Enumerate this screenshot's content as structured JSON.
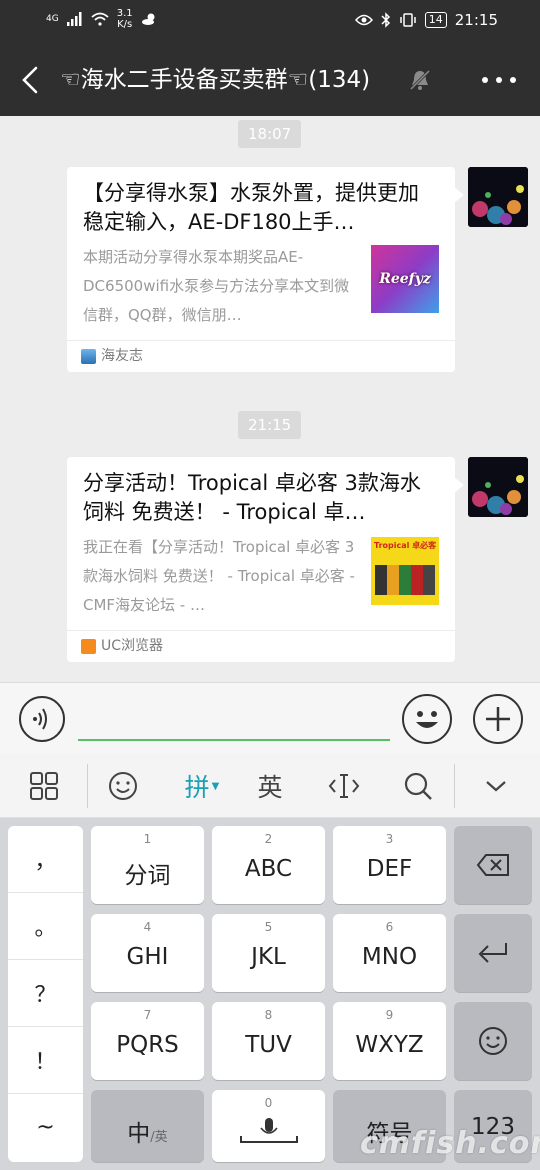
{
  "status_bar": {
    "network": "4G",
    "speed_value": "3.1",
    "speed_unit": "K/s",
    "battery": "14",
    "time": "21:15"
  },
  "header": {
    "title": "☜海水二手设备买卖群☜(134)"
  },
  "chat": {
    "messages": [
      {
        "timestamp": "18:07",
        "title": "【分享得水泵】水泵外置，提供更加稳定输入，AE-DF180上手…",
        "description": "本期活动分享得水泵本期奖品AE-DC6500wifi水泵参与方法分享本文到微信群，QQ群，微信朋…",
        "thumb_text": "Reefyz",
        "source": "海友志"
      },
      {
        "timestamp": "21:15",
        "title": "分享活动！Tropical 卓必客 3款海水饲料 免费送！ - Tropical 卓…",
        "description": "我正在看【分享活动！Tropical 卓必客 3款海水饲料 免费送！ - Tropical 卓必客 - CMF海友论坛 - …",
        "thumb_text": "Tropical 卓必客",
        "source": "UC浏览器"
      }
    ]
  },
  "ime_toolbar": {
    "pinyin_label": "拼",
    "english_label": "英"
  },
  "keyboard": {
    "punctuation": [
      "，",
      "。",
      "？",
      "！",
      "~"
    ],
    "keys": [
      {
        "num": "1",
        "label": "分词"
      },
      {
        "num": "2",
        "label": "ABC"
      },
      {
        "num": "3",
        "label": "DEF"
      },
      {
        "num": "4",
        "label": "GHI"
      },
      {
        "num": "5",
        "label": "JKL"
      },
      {
        "num": "6",
        "label": "MNO"
      },
      {
        "num": "7",
        "label": "PQRS"
      },
      {
        "num": "8",
        "label": "TUV"
      },
      {
        "num": "9",
        "label": "WXYZ"
      }
    ],
    "lang_key_main": "中",
    "lang_key_sub": "/英",
    "space_num": "0",
    "symbol_key": "符号",
    "num_key": "123"
  },
  "watermark": "cmfish.com",
  "colors": {
    "header_bg": "#2f2f2f",
    "chat_bg": "#ededed",
    "accent_green": "#57be6a",
    "ime_accent": "#1a9fb5"
  }
}
